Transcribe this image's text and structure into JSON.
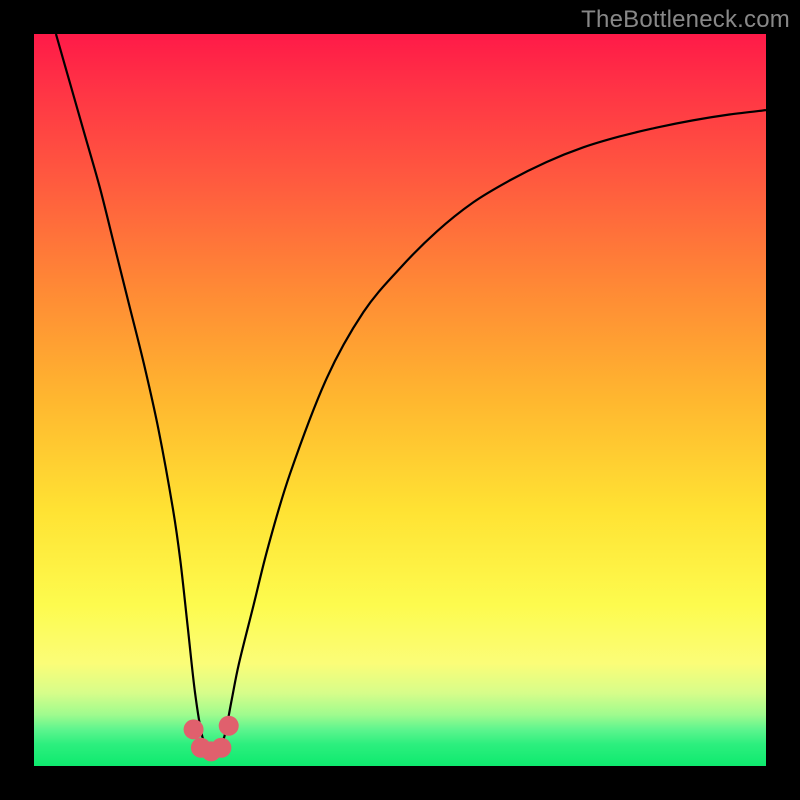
{
  "watermark": "TheBottleneck.com",
  "chart_data": {
    "type": "line",
    "title": "",
    "xlabel": "",
    "ylabel": "",
    "x_range": [
      0,
      100
    ],
    "y_range": [
      0,
      100
    ],
    "series": [
      {
        "name": "bottleneck-curve",
        "x": [
          3,
          5,
          7,
          9,
          11,
          13,
          15,
          17,
          19,
          20,
          21,
          22,
          23,
          24,
          25,
          26,
          27,
          28,
          30,
          32,
          35,
          40,
          45,
          50,
          55,
          60,
          65,
          70,
          75,
          80,
          85,
          90,
          95,
          100
        ],
        "values": [
          100,
          93,
          86,
          79,
          71,
          63,
          55,
          46,
          35,
          28,
          19,
          10,
          4,
          2,
          2,
          4,
          9,
          14,
          22,
          30,
          40,
          53,
          62,
          68,
          73,
          77,
          80,
          82.5,
          84.5,
          86,
          87.2,
          88.2,
          89,
          89.6
        ]
      }
    ],
    "markers": {
      "name": "optimum-cluster",
      "points": [
        {
          "x": 21.8,
          "y": 5.0
        },
        {
          "x": 22.8,
          "y": 2.5
        },
        {
          "x": 24.2,
          "y": 2.0
        },
        {
          "x": 25.6,
          "y": 2.5
        },
        {
          "x": 26.6,
          "y": 5.5
        }
      ],
      "color": "#e0606d"
    },
    "gradient": {
      "stops": [
        {
          "pct": 0,
          "color": "#ff1a48"
        },
        {
          "pct": 50,
          "color": "#ffb72f"
        },
        {
          "pct": 80,
          "color": "#fdfb4e"
        },
        {
          "pct": 100,
          "color": "#0eea6e"
        }
      ]
    }
  }
}
